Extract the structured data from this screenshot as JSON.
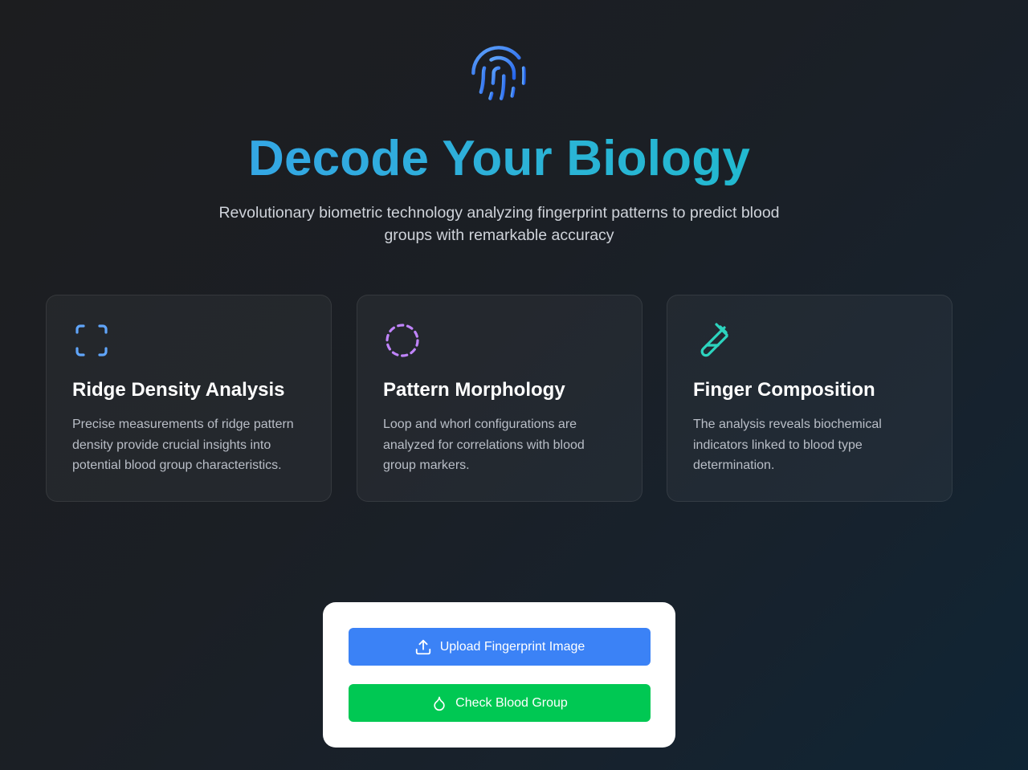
{
  "hero": {
    "icon": "fingerprint-icon",
    "title": "Decode Your Biology",
    "subtitle": "Revolutionary biometric technology analyzing fingerprint patterns to predict blood groups with remarkable accuracy"
  },
  "features": [
    {
      "icon": "scan-icon",
      "icon_color": "#60a5fa",
      "title": "Ridge Density Analysis",
      "description": "Precise measurements of ridge pattern density provide crucial insights into potential blood group characteristics."
    },
    {
      "icon": "dashed-circle-icon",
      "icon_color": "#c084fc",
      "title": "Pattern Morphology",
      "description": "Loop and whorl configurations are analyzed for correlations with blood group markers."
    },
    {
      "icon": "test-tube-icon",
      "icon_color": "#2dd4bf",
      "title": "Finger Composition",
      "description": "The analysis reveals biochemical indicators linked to blood type determination."
    }
  ],
  "actions": {
    "upload_label": "Upload Fingerprint Image",
    "upload_icon": "upload-icon",
    "upload_color": "#3b82f6",
    "check_label": "Check Blood Group",
    "check_icon": "droplet-icon",
    "check_color": "#00c853"
  }
}
